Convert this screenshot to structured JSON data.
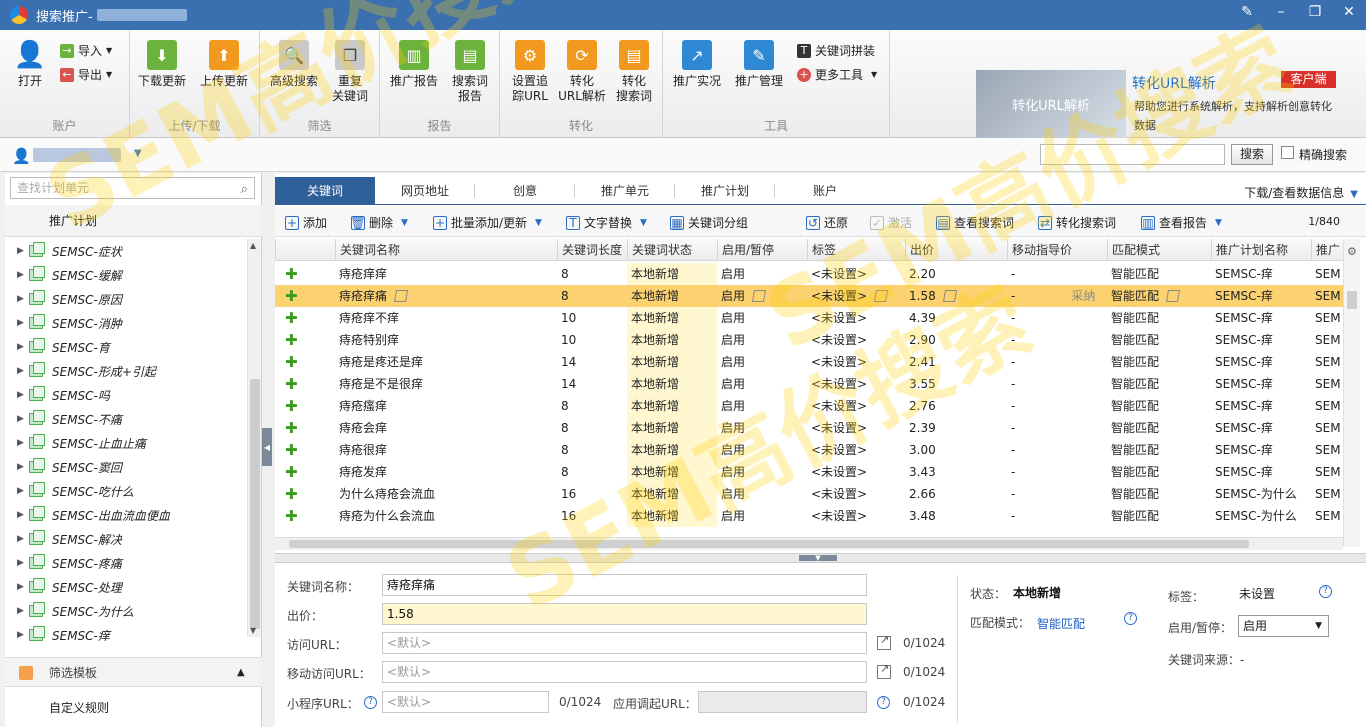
{
  "titlebar": {
    "title": "搜索推广-"
  },
  "ribbon": {
    "account": {
      "open": "打开",
      "import": "导入",
      "export": "导出",
      "label": "账户"
    },
    "transfer": {
      "download": "下载更新",
      "upload": "上传更新",
      "label": "上传/下载"
    },
    "filter": {
      "advanced": "高级搜索",
      "duplicate_1": "重复",
      "duplicate_2": "关键词",
      "label": "筛选"
    },
    "report": {
      "promo_report": "推广报告",
      "search_term_1": "搜索词",
      "search_term_2": "报告",
      "label": "报告"
    },
    "convert": {
      "track_1": "设置追",
      "track_2": "踪URL",
      "url_1": "转化",
      "url_2": "URL解析",
      "search_1": "转化",
      "search_2": "搜索词",
      "label": "转化"
    },
    "tools": {
      "live": "推广实况",
      "manage": "推广管理",
      "keyword_combine": "关键词拼装",
      "more_tools": "更多工具",
      "label": "工具"
    }
  },
  "banner": {
    "image_text": "转化URL解析",
    "title": "转化URL解析",
    "desc": "帮助您进行系统解析，支持解析创意转化数据",
    "badge": "客户端"
  },
  "accountbar": {
    "search_button": "搜索",
    "exact_label": "精确搜索"
  },
  "leftpanel": {
    "search_placeholder": "查找计划单元",
    "plan_header": "推广计划",
    "items": [
      "SEMSC-症状",
      "SEMSC-缓解",
      "SEMSC-原因",
      "SEMSC-消肿",
      "SEMSC-育",
      "SEMSC-形成+引起",
      "SEMSC-吗",
      "SEMSC-不痛",
      "SEMSC-止血止痛",
      "SEMSC-窦回",
      "SEMSC-吃什么",
      "SEMSC-出血流血便血",
      "SEMSC-解决",
      "SEMSC-疼痛",
      "SEMSC-处理",
      "SEMSC-为什么",
      "SEMSC-痒"
    ],
    "filter_template": "筛选模板",
    "custom_rule": "自定义规则"
  },
  "tabs": [
    "关键词",
    "网页地址",
    "创意",
    "推广单元",
    "推广计划",
    "账户"
  ],
  "download_info": "下载/查看数据信息",
  "toolbar": {
    "add": "添加",
    "delete": "删除",
    "batch_add": "批量添加/更新",
    "text_replace": "文字替换",
    "group": "关键词分组",
    "restore": "还原",
    "activate": "激活",
    "view_search": "查看搜索词",
    "convert_search": "转化搜索词",
    "view_report": "查看报告",
    "page_count": "1/840"
  },
  "grid": {
    "headers": [
      "关键词名称",
      "关键词长度",
      "关键词状态",
      "启用/暂停",
      "标签",
      "出价",
      "移动指导价",
      "匹配模式",
      "推广计划名称",
      "推广"
    ],
    "rows": [
      [
        "痔疮痒痒",
        "8",
        "本地新增",
        "启用",
        "<未设置>",
        "2.20",
        "-",
        "智能匹配",
        "SEMSC-痒",
        "SEM"
      ],
      [
        "痔疮痒痛",
        "8",
        "本地新增",
        "启用",
        "<未设置>",
        "1.58",
        "-",
        "智能匹配",
        "SEMSC-痒",
        "SEM"
      ],
      [
        "痔疮痒不痒",
        "10",
        "本地新增",
        "启用",
        "<未设置>",
        "4.39",
        "-",
        "智能匹配",
        "SEMSC-痒",
        "SEM"
      ],
      [
        "痔疮特别痒",
        "10",
        "本地新增",
        "启用",
        "<未设置>",
        "2.90",
        "-",
        "智能匹配",
        "SEMSC-痒",
        "SEM"
      ],
      [
        "痔疮是疼还是痒",
        "14",
        "本地新增",
        "启用",
        "<未设置>",
        "2.41",
        "-",
        "智能匹配",
        "SEMSC-痒",
        "SEM"
      ],
      [
        "痔疮是不是很痒",
        "14",
        "本地新增",
        "启用",
        "<未设置>",
        "3.55",
        "-",
        "智能匹配",
        "SEMSC-痒",
        "SEM"
      ],
      [
        "痔疮瘙痒",
        "8",
        "本地新增",
        "启用",
        "<未设置>",
        "2.76",
        "-",
        "智能匹配",
        "SEMSC-痒",
        "SEM"
      ],
      [
        "痔疮会痒",
        "8",
        "本地新增",
        "启用",
        "<未设置>",
        "2.39",
        "-",
        "智能匹配",
        "SEMSC-痒",
        "SEM"
      ],
      [
        "痔疮很痒",
        "8",
        "本地新增",
        "启用",
        "<未设置>",
        "3.00",
        "-",
        "智能匹配",
        "SEMSC-痒",
        "SEM"
      ],
      [
        "痔疮发痒",
        "8",
        "本地新增",
        "启用",
        "<未设置>",
        "3.43",
        "-",
        "智能匹配",
        "SEMSC-痒",
        "SEM"
      ],
      [
        "为什么痔疮会流血",
        "16",
        "本地新增",
        "启用",
        "<未设置>",
        "2.66",
        "-",
        "智能匹配",
        "SEMSC-为什么",
        "SEM"
      ],
      [
        "痔疮为什么会流血",
        "16",
        "本地新增",
        "启用",
        "<未设置>",
        "3.48",
        "-",
        "智能匹配",
        "SEMSC-为什么",
        "SEM"
      ]
    ],
    "selected_extra": "采纳"
  },
  "detail": {
    "keyword_label": "关键词名称：",
    "keyword_value": "痔疮痒痛",
    "bid_label": "出价：",
    "bid_value": "1.58",
    "url_label": "访问URL：",
    "url_placeholder": "<默认>",
    "url_count": "0/1024",
    "mobile_label": "移动访问URL：",
    "mobile_placeholder": "<默认>",
    "mobile_count": "0/1024",
    "mini_label": "小程序URL：",
    "mini_placeholder": "<默认>",
    "mini_count": "0/1024",
    "app_label": "应用调起URL：",
    "app_count": "0/1024",
    "status_label": "状态：",
    "status_value": "本地新增",
    "match_label": "匹配模式：",
    "match_value": "智能匹配",
    "tag_label": "标签：",
    "tag_value": "未设置",
    "toggle_label": "启用/暂停：",
    "toggle_value": "启用",
    "source_label": "关键词来源：-"
  },
  "watermark": "SEM高价搜索"
}
